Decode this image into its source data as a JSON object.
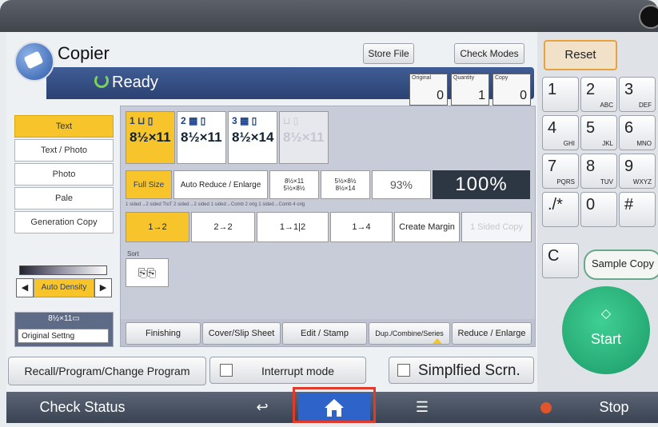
{
  "header": {
    "title": "Copier",
    "status": "Ready",
    "store_file": "Store File",
    "check_modes": "Check Modes",
    "counters": [
      {
        "label": "Original",
        "value": "0"
      },
      {
        "label": "Quantity",
        "value": "1"
      },
      {
        "label": "Copy",
        "value": "0"
      }
    ]
  },
  "original_type": {
    "items": [
      "Text",
      "Text / Photo",
      "Photo",
      "Pale",
      "Generation Copy"
    ],
    "selected": "Text"
  },
  "density": {
    "auto_label": "Auto Density",
    "left_icon": "left-arrow-icon",
    "right_icon": "right-arrow-icon"
  },
  "original": {
    "size": "8½×11▭",
    "settings_label": "Original Settng"
  },
  "paper_trays": [
    {
      "tray": "1 ⊔ ▯",
      "size": "8½×11",
      "selected": true
    },
    {
      "tray": "2 ▦ ▯",
      "size": "8½×11",
      "selected": false
    },
    {
      "tray": "3 ▦ ▯",
      "size": "8½×14",
      "selected": false
    },
    {
      "tray": "⊔ ▯",
      "size": "8½×11",
      "selected": false,
      "disabled": true
    }
  ],
  "ratio": {
    "full_size": "Full Size",
    "auto_reduce": "Auto Reduce / Enlarge",
    "preset_a_line1": "8½×11",
    "preset_a_line2": "5½×8½",
    "preset_b_line1": "5½×8½",
    "preset_b_line2": "8½×14",
    "percent_small": "93%",
    "percent_display": "100%"
  },
  "duplex": {
    "caption": "1 sided→2 sided TtoT    2 sided→2 sided    1 sided→Comb 2 orig 1 sided→Comb 4 orig",
    "buttons": [
      "1→2",
      "2→2",
      "1→1|2",
      "1→4",
      "Create Margin",
      "1 Sided Copy"
    ],
    "create_margin": "Create Margin",
    "one_sided": "1 Sided Copy"
  },
  "sort": {
    "label": "Sort",
    "glyph": "⎘⎘"
  },
  "tabs": [
    "Finishing",
    "Cover/Slip Sheet",
    "Edit / Stamp",
    "Dup./Combine/Series",
    "Reduce / Enlarge"
  ],
  "bottom_bar": {
    "recall": "Recall/Program/Change Program",
    "interrupt": "Interrupt mode",
    "simplified": "Simplfied Scrn."
  },
  "keypad": {
    "reset": "Reset",
    "keys": [
      {
        "main": "1",
        "sub": ""
      },
      {
        "main": "2",
        "sub": "ABC"
      },
      {
        "main": "3",
        "sub": "DEF"
      },
      {
        "main": "4",
        "sub": "GHI"
      },
      {
        "main": "5",
        "sub": "JKL"
      },
      {
        "main": "6",
        "sub": "MNO"
      },
      {
        "main": "7",
        "sub": "PQRS"
      },
      {
        "main": "8",
        "sub": "TUV"
      },
      {
        "main": "9",
        "sub": "WXYZ"
      },
      {
        "main": "./*",
        "sub": ""
      },
      {
        "main": "0",
        "sub": ""
      },
      {
        "main": "#",
        "sub": ""
      }
    ],
    "clear": "C",
    "sample_copy": "Sample Copy",
    "start": "Start",
    "start_symbol": "◇"
  },
  "footer": {
    "check_status": "Check Status",
    "back_icon": "back-arrow-icon",
    "home_icon": "home-icon",
    "menu_icon": "menu-icon",
    "stop": "Stop",
    "colors": {
      "home_highlight": "#e23a2a",
      "home_bg": "#2e64c9",
      "stop_dot": "#e0552b"
    }
  }
}
